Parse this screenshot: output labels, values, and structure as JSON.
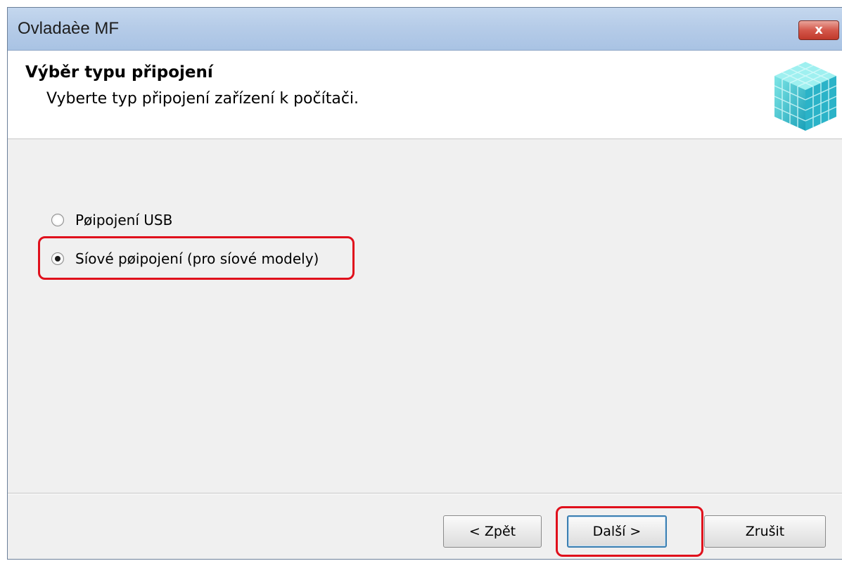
{
  "window": {
    "title": "Ovladaèe MF",
    "close_label": "x"
  },
  "header": {
    "title": "Výběr typu připojení",
    "subtitle": "Vyberte typ připojení zařízení k počítači."
  },
  "options": [
    {
      "label": "Pøipojení USB",
      "checked": false
    },
    {
      "label": "Síové pøipojení (pro síové modely)",
      "checked": true
    }
  ],
  "buttons": {
    "back": "< Zpět",
    "next": "Další >",
    "cancel": "Zrušit"
  },
  "colors": {
    "highlight": "#e0101c",
    "titlebar": "#b6cce8"
  },
  "icons": {
    "header": "blue-cube-grid-icon"
  }
}
